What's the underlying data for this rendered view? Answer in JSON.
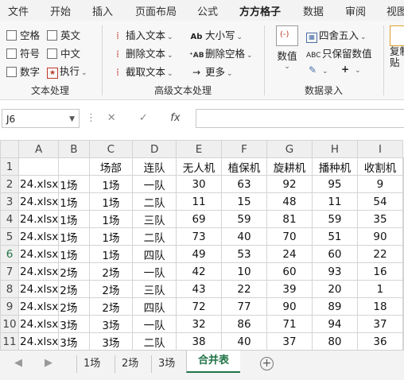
{
  "ribbon_tabs": [
    "文件",
    "开始",
    "插入",
    "页面布局",
    "公式",
    "方方格子",
    "数据",
    "审阅",
    "视图"
  ],
  "active_tab": "方方格子",
  "ribbon": {
    "text_processing": {
      "label": "文本处理",
      "checkboxes": [
        "空格",
        "英文",
        "符号",
        "中文",
        "数字"
      ],
      "execute": "执行"
    },
    "advanced_text": {
      "label": "高级文本处理",
      "left": [
        "插入文本",
        "删除文本",
        "截取文本"
      ],
      "right": [
        "大小写",
        "删除空格",
        "更多"
      ]
    },
    "data_entry": {
      "label": "数据录入",
      "value_button": "数值",
      "round": "四舍五入",
      "keep_value": "只保留数值",
      "partial_right": "复制\n贴"
    }
  },
  "formula_bar": {
    "name_box": "J6",
    "formula": ""
  },
  "grid": {
    "col_headers": [
      "A",
      "B",
      "C",
      "D",
      "E",
      "F",
      "G",
      "H",
      "I"
    ],
    "selected_row": "6",
    "rows": [
      {
        "n": "1",
        "cells": [
          "",
          "",
          "场部",
          "连队",
          "无人机",
          "植保机",
          "旋耕机",
          "播种机",
          "收割机"
        ]
      },
      {
        "n": "2",
        "cells": [
          "24.xlsx",
          "1场",
          "1场",
          "一队",
          "30",
          "63",
          "92",
          "95",
          "9"
        ]
      },
      {
        "n": "3",
        "cells": [
          "24.xlsx",
          "1场",
          "1场",
          "二队",
          "11",
          "15",
          "48",
          "11",
          "54"
        ]
      },
      {
        "n": "4",
        "cells": [
          "24.xlsx",
          "1场",
          "1场",
          "三队",
          "69",
          "59",
          "81",
          "59",
          "35"
        ]
      },
      {
        "n": "5",
        "cells": [
          "24.xlsx",
          "1场",
          "1场",
          "二队",
          "73",
          "40",
          "70",
          "51",
          "90"
        ]
      },
      {
        "n": "6",
        "cells": [
          "24.xlsx",
          "1场",
          "1场",
          "四队",
          "49",
          "53",
          "24",
          "60",
          "22"
        ]
      },
      {
        "n": "7",
        "cells": [
          "24.xlsx",
          "2场",
          "2场",
          "一队",
          "42",
          "10",
          "60",
          "93",
          "16"
        ]
      },
      {
        "n": "8",
        "cells": [
          "24.xlsx",
          "2场",
          "2场",
          "三队",
          "43",
          "22",
          "39",
          "20",
          "1"
        ]
      },
      {
        "n": "9",
        "cells": [
          "24.xlsx",
          "2场",
          "2场",
          "四队",
          "72",
          "77",
          "90",
          "89",
          "18"
        ]
      },
      {
        "n": "10",
        "cells": [
          "24.xlsx",
          "3场",
          "3场",
          "一队",
          "32",
          "86",
          "71",
          "94",
          "37"
        ]
      },
      {
        "n": "11",
        "cells": [
          "24.xlsx",
          "3场",
          "3场",
          "二队",
          "38",
          "40",
          "37",
          "80",
          "36"
        ]
      },
      {
        "n": "12",
        "cells": [
          "24.xlsx",
          "3场",
          "3场",
          "三队",
          "80",
          "80",
          "88",
          "13",
          "85"
        ]
      },
      {
        "n": "13",
        "cells": [
          "24.xlsx",
          "3场",
          "3场",
          "四队",
          "23",
          "29",
          "69",
          "17",
          "35"
        ]
      }
    ]
  },
  "sheet_tabs": [
    "1场",
    "2场",
    "3场",
    "合并表"
  ],
  "active_sheet": "合并表",
  "colors": {
    "accent": "#217346"
  }
}
